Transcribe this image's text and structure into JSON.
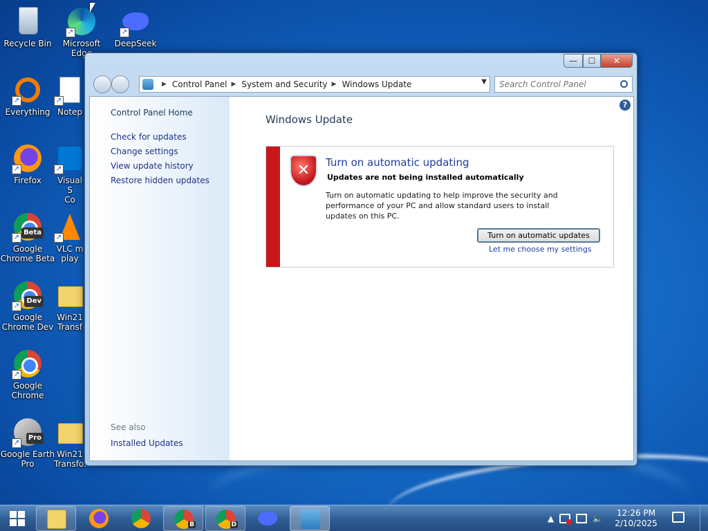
{
  "desktop": {
    "icons": [
      {
        "label": "Recycle Bin"
      },
      {
        "label": "Microsoft\nEdge"
      },
      {
        "label": "DeepSeek"
      },
      {
        "label": "Everything"
      },
      {
        "label": "Notep"
      },
      {
        "label": "Firefox"
      },
      {
        "label": "Visual S\nCo"
      },
      {
        "label": "Google\nChrome Beta",
        "badge": "Beta"
      },
      {
        "label": "VLC m\nplay"
      },
      {
        "label": "Google\nChrome Dev",
        "badge": "Dev"
      },
      {
        "label": "Win21\nTransf"
      },
      {
        "label": "Google\nChrome"
      },
      {
        "label": "Google Earth\nPro",
        "badge": "Pro"
      },
      {
        "label": "Win21\nTransfo..."
      }
    ]
  },
  "window": {
    "breadcrumb": [
      "Control Panel",
      "System and Security",
      "Windows Update"
    ],
    "search_placeholder": "Search Control Panel",
    "controls": {
      "minimize": "—",
      "maximize": "☐",
      "close": "✕"
    }
  },
  "sidebar": {
    "home": "Control Panel Home",
    "links": [
      "Check for updates",
      "Change settings",
      "View update history",
      "Restore hidden updates"
    ],
    "see_also": "See also",
    "installed_updates": "Installed Updates"
  },
  "main": {
    "title": "Windows Update",
    "alert": {
      "heading": "Turn on automatic updating",
      "subheading": "Updates are not being installed automatically",
      "description": "Turn on automatic updating to help improve the security and performance of your PC and allow standard users to install updates on this PC.",
      "primary_button": "Turn on automatic updates",
      "secondary_link": "Let me choose my settings"
    },
    "help": "?"
  },
  "taskbar": {
    "badges": {
      "beta": "B",
      "dev": "D"
    },
    "clock": {
      "time": "12:26 PM",
      "date": "2/10/2025"
    }
  },
  "colors": {
    "alert_bar": "#c8161d",
    "link": "#1e3287",
    "accent": "#1e3d9b"
  }
}
